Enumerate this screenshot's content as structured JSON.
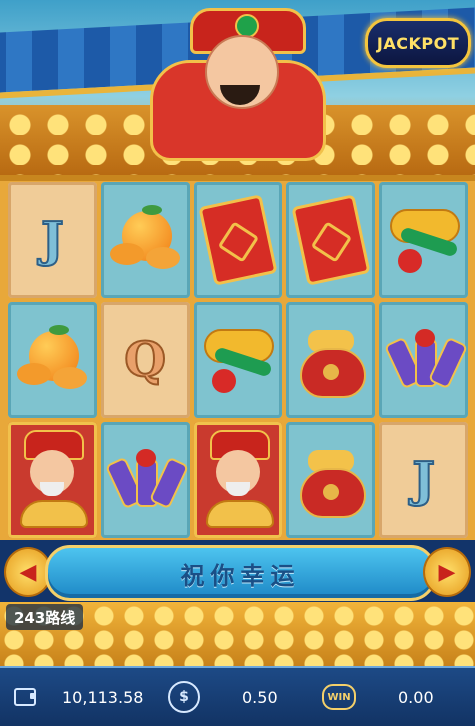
{
  "jackpot": {
    "label": "JACKPOT"
  },
  "reels": {
    "cells": [
      {
        "symbol": "J",
        "tile": "tan"
      },
      {
        "symbol": "orange",
        "tile": "teal"
      },
      {
        "symbol": "red-envelope",
        "tile": "teal"
      },
      {
        "symbol": "red-envelope",
        "tile": "teal"
      },
      {
        "symbol": "ruyi",
        "tile": "teal"
      },
      {
        "symbol": "orange",
        "tile": "teal"
      },
      {
        "symbol": "Q",
        "tile": "tan"
      },
      {
        "symbol": "ruyi",
        "tile": "teal"
      },
      {
        "symbol": "money-bag",
        "tile": "teal"
      },
      {
        "symbol": "firecrackers",
        "tile": "teal"
      },
      {
        "symbol": "fortune-god",
        "tile": "red"
      },
      {
        "symbol": "firecrackers",
        "tile": "teal"
      },
      {
        "symbol": "fortune-god",
        "tile": "red"
      },
      {
        "symbol": "money-bag",
        "tile": "teal"
      },
      {
        "symbol": "J",
        "tile": "tan"
      }
    ]
  },
  "banner": {
    "text": "祝你幸运"
  },
  "ways": {
    "label": "243路线"
  },
  "bottom_bar": {
    "balance": "10,113.58",
    "bet": "0.50",
    "win": "0.00",
    "win_icon_text": "WIN",
    "bet_icon_text": "$"
  },
  "colors": {
    "accent_gold": "#f4c53d",
    "bar_blue": "#123364",
    "banner_blue": "#1d88c6"
  }
}
